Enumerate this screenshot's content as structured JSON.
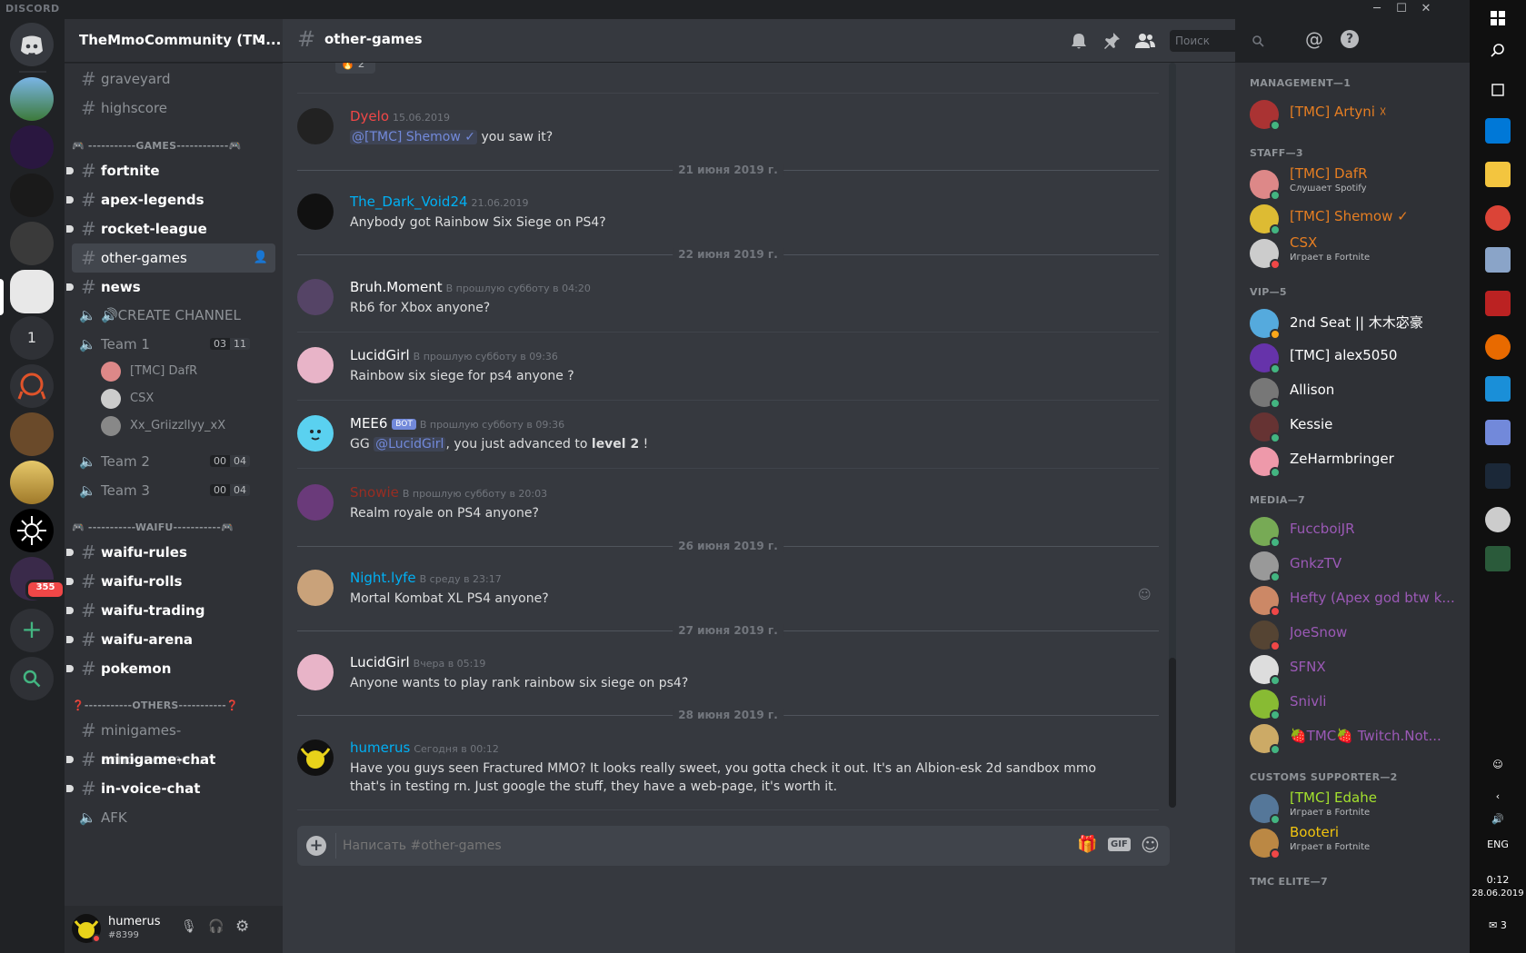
{
  "window": {
    "brand": "DISCORD",
    "minimize": "─",
    "maximize": "☐",
    "close": "✕"
  },
  "guilds": {
    "badge_1": "1",
    "mention_count": "355",
    "add_icon": "plus-icon",
    "search_icon": "search-icon"
  },
  "server": {
    "name": "TheMmoCommunity (TM...",
    "chevron": "⌄"
  },
  "channels": {
    "graveyard": "graveyard",
    "highscore": "highscore",
    "cat_games": "🎮 -----------GAMES------------🎮",
    "fortnite": "fortnite",
    "apex": "apex-legends",
    "rocket": "rocket-league",
    "other_games": "other-games",
    "news": "news",
    "create": "🔊CREATE CHANNEL",
    "team1": "Team 1",
    "team1_a": "03",
    "team1_b": "11",
    "team2": "Team 2",
    "team2_a": "00",
    "team2_b": "04",
    "team3": "Team 3",
    "team3_a": "00",
    "team3_b": "04",
    "voice_users": [
      "[TMC] DafR",
      "CSX",
      "Xx_Griizzllyy_xX"
    ],
    "cat_waifu": "🎮 -----------WAIFU-----------🎮",
    "waifu_rules": "waifu-rules",
    "waifu_rolls": "waifu-rolls",
    "waifu_trading": "waifu-trading",
    "waifu_arena": "waifu-arena",
    "pokemon": "pokemon",
    "cat_others": "❓-----------OTHERS-----------❓",
    "minigames_ann": "minigames-announceme...",
    "minigame_chat": "minigame-chat",
    "in_voice": "in-voice-chat",
    "afk": "AFK"
  },
  "user": {
    "name": "humerus",
    "tag": "#8399"
  },
  "chat": {
    "channel": "other-games",
    "reaction_count": "2",
    "search_placeholder": "Поиск",
    "composer_placeholder": "Написать #other-games",
    "gif": "GIF",
    "dates": [
      "21 июня 2019 г.",
      "22 июня 2019 г.",
      "26 июня 2019 г.",
      "27 июня 2019 г.",
      "28 июня 2019 г."
    ],
    "messages": [
      {
        "author": "Dyelo",
        "time": "15.06.2019",
        "mention": "@[TMC] Shemow ✓",
        "text": " you saw it?",
        "color": "#f04747"
      },
      {
        "author": "The_Dark_Void24",
        "time": "21.06.2019",
        "text": "Anybody got Rainbow Six Siege on PS4?",
        "color": "#00b0f4"
      },
      {
        "author": "Bruh.Moment",
        "time": "В прошлую субботу в 04:20",
        "text": "Rb6 for Xbox anyone?",
        "color": "#ffffff"
      },
      {
        "author": "LucidGirl",
        "time": "В прошлую субботу в 09:36",
        "text": "Rainbow six siege for ps4 anyone ?",
        "color": "#ffffff"
      },
      {
        "author": "MEE6",
        "bot": "BOT",
        "time": "В прошлую субботу в 09:36",
        "pre": "GG ",
        "mention": "@LucidGirl",
        "mid": ", you just advanced to ",
        "bold": "level 2",
        "post": " !",
        "color": "#ffffff"
      },
      {
        "author": "Snowie",
        "time": "В прошлую субботу в 20:03",
        "text": "Realm royale on PS4 anyone?",
        "color": "#992d22"
      },
      {
        "author": "Night.lyfe",
        "time": "В среду в 23:17",
        "text": "Mortal Kombat XL PS4 anyone?",
        "color": "#00b0f4"
      },
      {
        "author": "LucidGirl",
        "time": "Вчера в 05:19",
        "text": "Anyone wants to play rank rainbow six siege on ps4?",
        "color": "#ffffff"
      },
      {
        "author": "humerus",
        "time": "Сегодня в 00:12",
        "text": "Have you guys seen Fractured MMO? It looks really sweet, you gotta check it out. It's an Albion-esk 2d sandbox mmo that's in testing rn. Just google the stuff, they have a web-page, it's worth it.",
        "color": "#00b0f4"
      }
    ]
  },
  "members": {
    "groups": [
      {
        "label": "MANAGEMENT—1",
        "members": [
          {
            "name": "[TMC] Artyni ☓",
            "color": "#e67e22",
            "status": "#43b581",
            "av": "#a33"
          }
        ]
      },
      {
        "label": "STAFF—3",
        "members": [
          {
            "name": "[TMC] DafR",
            "sub": "Слушает Spotify",
            "color": "#e67e22",
            "status": "#43b581",
            "av": "#d88"
          },
          {
            "name": "[TMC] Shemow ✓",
            "color": "#e67e22",
            "status": "#43b581",
            "av": "#db3"
          },
          {
            "name": "CSX",
            "sub": "Играет в Fortnite",
            "color": "#e67e22",
            "status": "#f04747",
            "av": "#ccc"
          }
        ]
      },
      {
        "label": "VIP—5",
        "members": [
          {
            "name": "2nd Seat || 木木宓豪",
            "color": "#ffffff",
            "status": "#faa61a",
            "av": "#5ad"
          },
          {
            "name": "[TMC] alex5050",
            "color": "#ffffff",
            "status": "#43b581",
            "av": "#63a"
          },
          {
            "name": "Allison",
            "color": "#ffffff",
            "status": "#43b581",
            "av": "#777"
          },
          {
            "name": "Kessie",
            "color": "#ffffff",
            "status": "#43b581",
            "av": "#633"
          },
          {
            "name": "ZeHarmbringer",
            "color": "#ffffff",
            "status": "#43b581",
            "av": "#e9a"
          }
        ]
      },
      {
        "label": "MEDIA—7",
        "members": [
          {
            "name": "FuccboiJR",
            "color": "#9b59b6",
            "status": "#43b581",
            "av": "#7a5"
          },
          {
            "name": "GnkzTV",
            "color": "#9b59b6",
            "status": "#43b581",
            "av": "#999"
          },
          {
            "name": "Hefty (Apex god btw k...",
            "color": "#9b59b6",
            "status": "#f04747",
            "av": "#c86"
          },
          {
            "name": "JoeSnow",
            "color": "#9b59b6",
            "status": "#f04747",
            "av": "#543"
          },
          {
            "name": "SFNX",
            "color": "#9b59b6",
            "status": "#43b581",
            "av": "#ddd"
          },
          {
            "name": "Snivli",
            "color": "#9b59b6",
            "status": "#43b581",
            "av": "#8b3"
          },
          {
            "name": "🍓TMC🍓 Twitch.Not...",
            "color": "#9b59b6",
            "status": "#43b581",
            "av": "#ca6"
          }
        ]
      },
      {
        "label": "CUSTOMS SUPPORTER—2",
        "members": [
          {
            "name": "[TMC] Edahe",
            "sub": "Играет в Fortnite",
            "color": "#a4e22e",
            "status": "#43b581",
            "av": "#579"
          },
          {
            "name": "Booteri",
            "sub": "Играет в Fortnite",
            "color": "#f1c40f",
            "status": "#f04747",
            "av": "#b84"
          }
        ]
      },
      {
        "label": "TMC ELITE—7",
        "members": []
      }
    ]
  },
  "taskbar": {
    "lang": "ENG",
    "time": "0:12",
    "date": "28.06.2019",
    "notif": "3"
  }
}
